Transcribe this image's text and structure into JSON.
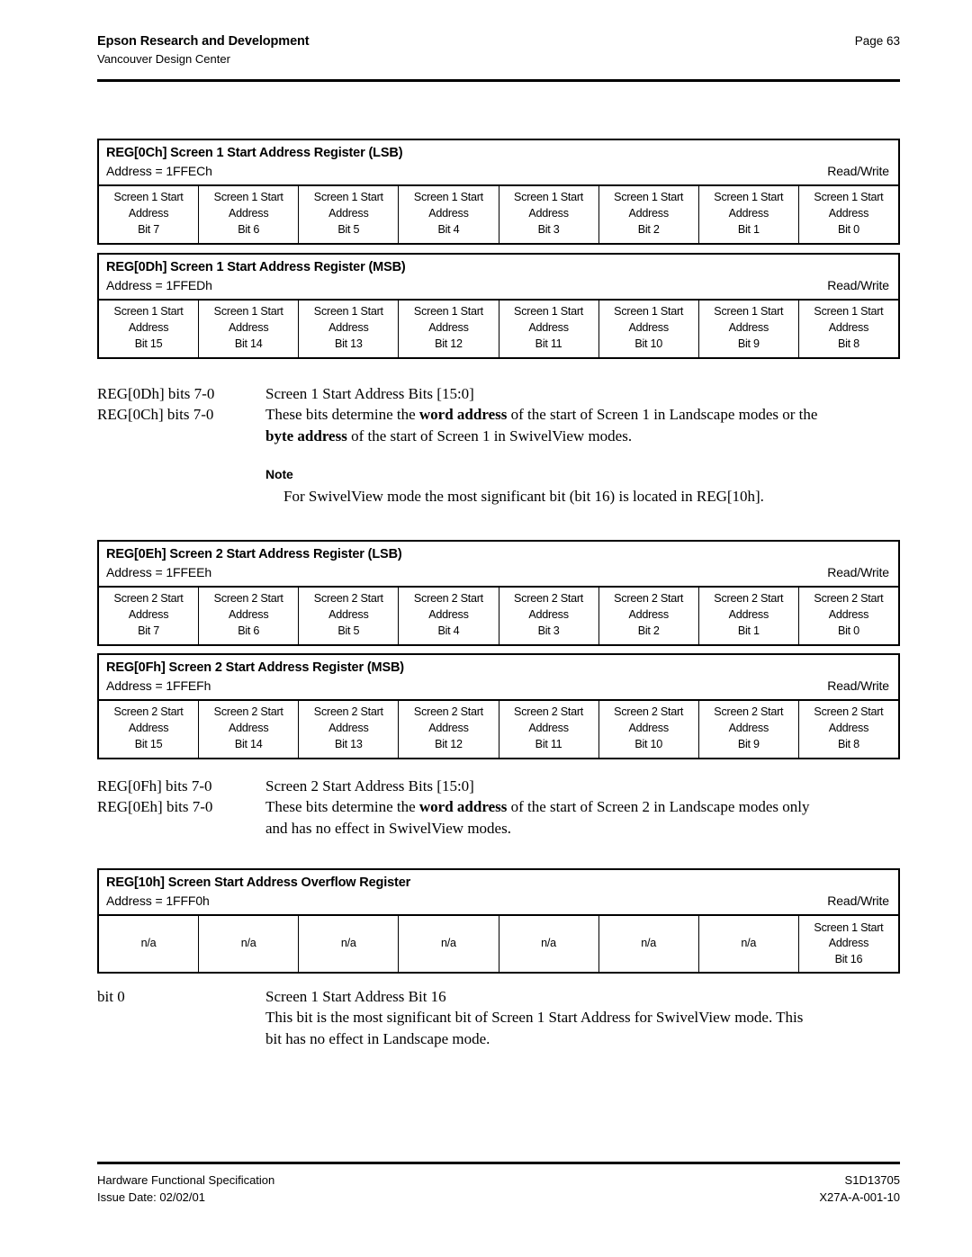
{
  "header": {
    "title": "Epson Research and Development",
    "subtitle": "Vancouver Design Center",
    "page": "Page 63"
  },
  "registers": [
    {
      "title": "REG[0Ch] Screen 1 Start Address Register (LSB)",
      "address": "Address = 1FFECh",
      "access": "Read/Write",
      "cells": [
        {
          "l1": "Screen 1 Start",
          "l2": "Address",
          "l3": "Bit 7"
        },
        {
          "l1": "Screen 1 Start",
          "l2": "Address",
          "l3": "Bit 6"
        },
        {
          "l1": "Screen 1 Start",
          "l2": "Address",
          "l3": "Bit 5"
        },
        {
          "l1": "Screen 1 Start",
          "l2": "Address",
          "l3": "Bit 4"
        },
        {
          "l1": "Screen 1 Start",
          "l2": "Address",
          "l3": "Bit 3"
        },
        {
          "l1": "Screen 1 Start",
          "l2": "Address",
          "l3": "Bit 2"
        },
        {
          "l1": "Screen 1 Start",
          "l2": "Address",
          "l3": "Bit 1"
        },
        {
          "l1": "Screen 1 Start",
          "l2": "Address",
          "l3": "Bit 0"
        }
      ]
    },
    {
      "title": "REG[0Dh] Screen 1 Start Address Register (MSB)",
      "address": "Address = 1FFEDh",
      "access": "Read/Write",
      "cells": [
        {
          "l1": "Screen 1 Start",
          "l2": "Address",
          "l3": "Bit 15"
        },
        {
          "l1": "Screen 1 Start",
          "l2": "Address",
          "l3": "Bit 14"
        },
        {
          "l1": "Screen 1 Start",
          "l2": "Address",
          "l3": "Bit 13"
        },
        {
          "l1": "Screen 1 Start",
          "l2": "Address",
          "l3": "Bit 12"
        },
        {
          "l1": "Screen 1 Start",
          "l2": "Address",
          "l3": "Bit 11"
        },
        {
          "l1": "Screen 1 Start",
          "l2": "Address",
          "l3": "Bit 10"
        },
        {
          "l1": "Screen 1 Start",
          "l2": "Address",
          "l3": "Bit 9"
        },
        {
          "l1": "Screen 1 Start",
          "l2": "Address",
          "l3": "Bit 8"
        }
      ]
    },
    {
      "title": "REG[0Eh] Screen 2 Start Address Register (LSB)",
      "address": "Address = 1FFEEh",
      "access": "Read/Write",
      "cells": [
        {
          "l1": "Screen 2 Start",
          "l2": "Address",
          "l3": "Bit 7"
        },
        {
          "l1": "Screen 2 Start",
          "l2": "Address",
          "l3": "Bit 6"
        },
        {
          "l1": "Screen 2 Start",
          "l2": "Address",
          "l3": "Bit 5"
        },
        {
          "l1": "Screen 2 Start",
          "l2": "Address",
          "l3": "Bit 4"
        },
        {
          "l1": "Screen 2 Start",
          "l2": "Address",
          "l3": "Bit 3"
        },
        {
          "l1": "Screen 2 Start",
          "l2": "Address",
          "l3": "Bit 2"
        },
        {
          "l1": "Screen 2 Start",
          "l2": "Address",
          "l3": "Bit 1"
        },
        {
          "l1": "Screen 2 Start",
          "l2": "Address",
          "l3": "Bit 0"
        }
      ]
    },
    {
      "title": "REG[0Fh] Screen 2 Start Address Register (MSB)",
      "address": "Address = 1FFEFh",
      "access": "Read/Write",
      "cells": [
        {
          "l1": "Screen 2 Start",
          "l2": "Address",
          "l3": "Bit 15"
        },
        {
          "l1": "Screen 2 Start",
          "l2": "Address",
          "l3": "Bit 14"
        },
        {
          "l1": "Screen 2 Start",
          "l2": "Address",
          "l3": "Bit 13"
        },
        {
          "l1": "Screen 2 Start",
          "l2": "Address",
          "l3": "Bit 12"
        },
        {
          "l1": "Screen 2 Start",
          "l2": "Address",
          "l3": "Bit 11"
        },
        {
          "l1": "Screen 2 Start",
          "l2": "Address",
          "l3": "Bit 10"
        },
        {
          "l1": "Screen 2 Start",
          "l2": "Address",
          "l3": "Bit 9"
        },
        {
          "l1": "Screen 2 Start",
          "l2": "Address",
          "l3": "Bit 8"
        }
      ]
    },
    {
      "title": "REG[10h] Screen Start Address Overflow Register",
      "address": "Address = 1FFF0h",
      "access": "Read/Write",
      "cells": [
        {
          "l1": "",
          "l2": "n/a",
          "l3": ""
        },
        {
          "l1": "",
          "l2": "n/a",
          "l3": ""
        },
        {
          "l1": "",
          "l2": "n/a",
          "l3": ""
        },
        {
          "l1": "",
          "l2": "n/a",
          "l3": ""
        },
        {
          "l1": "",
          "l2": "n/a",
          "l3": ""
        },
        {
          "l1": "",
          "l2": "n/a",
          "l3": ""
        },
        {
          "l1": "",
          "l2": "n/a",
          "l3": ""
        },
        {
          "l1": "Screen 1 Start",
          "l2": "Address",
          "l3": "Bit 16"
        }
      ]
    }
  ],
  "descriptions": [
    {
      "label_1": "REG[0Dh] bits 7-0",
      "label_2": "REG[0Ch] bits 7-0",
      "line_1": "Screen 1 Start Address Bits [15:0]",
      "line_2_a": "These bits determine the ",
      "line_2_b": "word address",
      "line_2_c": " of the start of Screen 1 in Landscape modes or the",
      "line_3_a": "byte address",
      "line_3_b": " of the start of Screen 1 in SwivelView modes.",
      "note_title": "Note",
      "note_text": "For SwivelView mode the most significant bit (bit 16) is located in REG[10h]."
    },
    {
      "label_1": "REG[0Fh] bits 7-0",
      "label_2": "REG[0Eh] bits 7-0",
      "line_1": "Screen 2 Start Address Bits [15:0]",
      "line_2_a": "These bits determine the ",
      "line_2_b": "word address",
      "line_2_c": " of the start of Screen 2 in Landscape modes only",
      "line_3_b": "and has no effect in SwivelView modes."
    },
    {
      "label_1": "bit 0",
      "line_1": "Screen 1 Start Address Bit 16",
      "line_2_a": "This bit is the most significant bit of Screen 1 Start Address for SwivelView mode. This",
      "line_3_b": "bit has no effect in Landscape mode."
    }
  ],
  "footer": {
    "left_1": "Hardware Functional Specification",
    "left_2": "Issue Date: 02/02/01",
    "right_1": "S1D13705",
    "right_2": "X27A-A-001-10"
  }
}
